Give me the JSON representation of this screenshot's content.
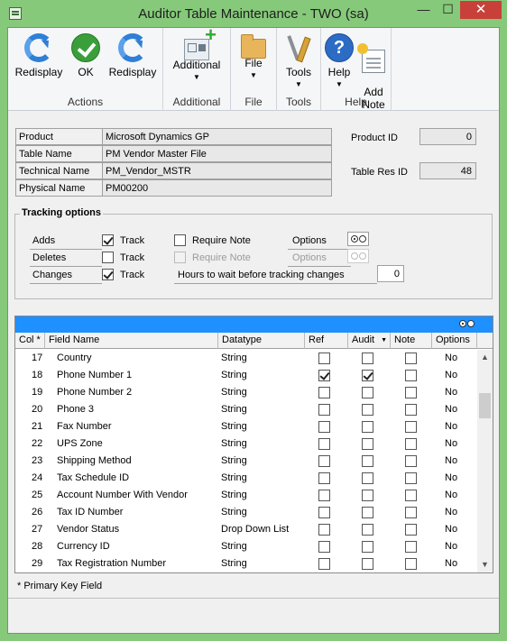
{
  "window": {
    "title": "Auditor Table Maintenance  -  TWO (sa)",
    "min_symbol": "—",
    "max_symbol": "☐",
    "close_symbol": "✕"
  },
  "ribbon": {
    "groups": [
      {
        "caption": "Actions",
        "buttons": [
          {
            "label": "Redisplay",
            "icon": "redisplay-icon"
          },
          {
            "label": "OK",
            "icon": "ok-icon"
          },
          {
            "label": "Redisplay",
            "icon": "redisplay-icon"
          }
        ]
      },
      {
        "caption": "Additional",
        "buttons": [
          {
            "label": "Additional",
            "icon": "additional-icon",
            "dropdown": "▼"
          }
        ]
      },
      {
        "caption": "File",
        "buttons": [
          {
            "label": "File",
            "icon": "folder-icon",
            "dropdown": "▼"
          }
        ]
      },
      {
        "caption": "Tools",
        "buttons": [
          {
            "label": "Tools",
            "icon": "tools-icon",
            "dropdown": "▼"
          }
        ]
      },
      {
        "caption": "Help",
        "buttons": [
          {
            "label": "Help",
            "icon": "help-icon",
            "dropdown": "▼"
          },
          {
            "label": "Add\nNote",
            "icon": "note-icon"
          }
        ]
      }
    ]
  },
  "info": {
    "product_label": "Product",
    "product_value": "Microsoft Dynamics GP",
    "table_name_label": "Table Name",
    "table_name_value": "PM Vendor Master File",
    "technical_name_label": "Technical Name",
    "technical_name_value": "PM_Vendor_MSTR",
    "physical_name_label": "Physical Name",
    "physical_name_value": "PM00200",
    "product_id_label": "Product ID",
    "product_id_value": "0",
    "table_res_id_label": "Table Res ID",
    "table_res_id_value": "48"
  },
  "tracking": {
    "title": "Tracking options",
    "adds_label": "Adds",
    "deletes_label": "Deletes",
    "changes_label": "Changes",
    "track_label": "Track",
    "adds_track": true,
    "deletes_track": false,
    "changes_track": true,
    "require_note_label": "Require Note",
    "options_label": "Options",
    "hours_label": "Hours to wait before tracking changes",
    "hours_value": "0"
  },
  "grid": {
    "columns": [
      "Col *",
      "Field Name",
      "Datatype",
      "Ref",
      "Audit",
      "Note",
      "Options"
    ],
    "rows": [
      {
        "col": "17",
        "field": "Country",
        "datatype": "String",
        "ref": false,
        "audit": false,
        "note": false,
        "options": "No"
      },
      {
        "col": "18",
        "field": "Phone Number 1",
        "datatype": "String",
        "ref": true,
        "audit": true,
        "note": false,
        "options": "No"
      },
      {
        "col": "19",
        "field": "Phone Number 2",
        "datatype": "String",
        "ref": false,
        "audit": false,
        "note": false,
        "options": "No"
      },
      {
        "col": "20",
        "field": "Phone 3",
        "datatype": "String",
        "ref": false,
        "audit": false,
        "note": false,
        "options": "No"
      },
      {
        "col": "21",
        "field": "Fax Number",
        "datatype": "String",
        "ref": false,
        "audit": false,
        "note": false,
        "options": "No"
      },
      {
        "col": "22",
        "field": "UPS Zone",
        "datatype": "String",
        "ref": false,
        "audit": false,
        "note": false,
        "options": "No"
      },
      {
        "col": "23",
        "field": "Shipping Method",
        "datatype": "String",
        "ref": false,
        "audit": false,
        "note": false,
        "options": "No"
      },
      {
        "col": "24",
        "field": "Tax Schedule ID",
        "datatype": "String",
        "ref": false,
        "audit": false,
        "note": false,
        "options": "No"
      },
      {
        "col": "25",
        "field": "Account Number With Vendor",
        "datatype": "String",
        "ref": false,
        "audit": false,
        "note": false,
        "options": "No"
      },
      {
        "col": "26",
        "field": "Tax ID Number",
        "datatype": "String",
        "ref": false,
        "audit": false,
        "note": false,
        "options": "No"
      },
      {
        "col": "27",
        "field": "Vendor Status",
        "datatype": "Drop Down List",
        "ref": false,
        "audit": false,
        "note": false,
        "options": "No"
      },
      {
        "col": "28",
        "field": "Currency ID",
        "datatype": "String",
        "ref": false,
        "audit": false,
        "note": false,
        "options": "No"
      },
      {
        "col": "29",
        "field": "Tax Registration Number",
        "datatype": "String",
        "ref": false,
        "audit": false,
        "note": false,
        "options": "No"
      }
    ]
  },
  "footer": {
    "note": "* Primary Key Field"
  },
  "colors": {
    "window_frame": "#86c97a",
    "grid_header_bar": "#1e90ff",
    "close_button": "#c7413a"
  }
}
